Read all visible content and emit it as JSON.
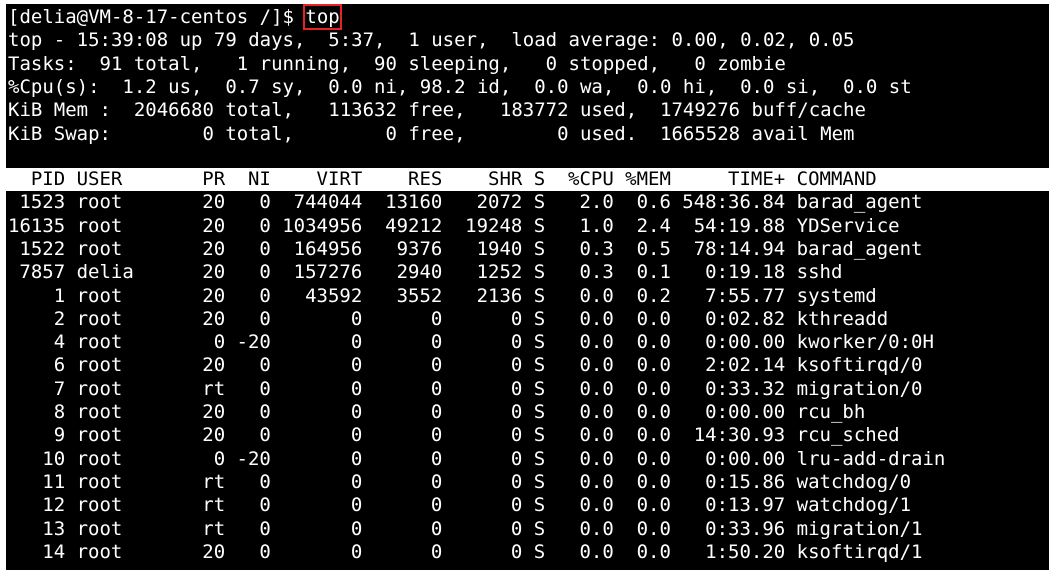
{
  "prompt": {
    "text": "[delia@VM-8-17-centos /]$ ",
    "command": "top"
  },
  "summary": [
    "top - 15:39:08 up 79 days,  5:37,  1 user,  load average: 0.00, 0.02, 0.05",
    "Tasks:  91 total,   1 running,  90 sleeping,   0 stopped,   0 zombie",
    "%Cpu(s):  1.2 us,  0.7 sy,  0.0 ni, 98.2 id,  0.0 wa,  0.0 hi,  0.0 si,  0.0 st",
    "KiB Mem :  2046680 total,   113632 free,   183772 used,  1749276 buff/cache",
    "KiB Swap:        0 total,        0 free,        0 used.  1665528 avail Mem"
  ],
  "columns": [
    "PID",
    "USER",
    "PR",
    "NI",
    "VIRT",
    "RES",
    "SHR",
    "S",
    "%CPU",
    "%MEM",
    "TIME+",
    "COMMAND"
  ],
  "rows": [
    [
      "1523",
      "root",
      "20",
      "0",
      "744044",
      "13160",
      "2072",
      "S",
      "2.0",
      "0.6",
      "548:36.84",
      "barad_agent"
    ],
    [
      "16135",
      "root",
      "20",
      "0",
      "1034956",
      "49212",
      "19248",
      "S",
      "1.0",
      "2.4",
      "54:19.88",
      "YDService"
    ],
    [
      "1522",
      "root",
      "20",
      "0",
      "164956",
      "9376",
      "1940",
      "S",
      "0.3",
      "0.5",
      "78:14.94",
      "barad_agent"
    ],
    [
      "7857",
      "delia",
      "20",
      "0",
      "157276",
      "2940",
      "1252",
      "S",
      "0.3",
      "0.1",
      "0:19.18",
      "sshd"
    ],
    [
      "1",
      "root",
      "20",
      "0",
      "43592",
      "3552",
      "2136",
      "S",
      "0.0",
      "0.2",
      "7:55.77",
      "systemd"
    ],
    [
      "2",
      "root",
      "20",
      "0",
      "0",
      "0",
      "0",
      "S",
      "0.0",
      "0.0",
      "0:02.82",
      "kthreadd"
    ],
    [
      "4",
      "root",
      "0",
      "-20",
      "0",
      "0",
      "0",
      "S",
      "0.0",
      "0.0",
      "0:00.00",
      "kworker/0:0H"
    ],
    [
      "6",
      "root",
      "20",
      "0",
      "0",
      "0",
      "0",
      "S",
      "0.0",
      "0.0",
      "2:02.14",
      "ksoftirqd/0"
    ],
    [
      "7",
      "root",
      "rt",
      "0",
      "0",
      "0",
      "0",
      "S",
      "0.0",
      "0.0",
      "0:33.32",
      "migration/0"
    ],
    [
      "8",
      "root",
      "20",
      "0",
      "0",
      "0",
      "0",
      "S",
      "0.0",
      "0.0",
      "0:00.00",
      "rcu_bh"
    ],
    [
      "9",
      "root",
      "20",
      "0",
      "0",
      "0",
      "0",
      "S",
      "0.0",
      "0.0",
      "14:30.93",
      "rcu_sched"
    ],
    [
      "10",
      "root",
      "0",
      "-20",
      "0",
      "0",
      "0",
      "S",
      "0.0",
      "0.0",
      "0:00.00",
      "lru-add-drain"
    ],
    [
      "11",
      "root",
      "rt",
      "0",
      "0",
      "0",
      "0",
      "S",
      "0.0",
      "0.0",
      "0:15.86",
      "watchdog/0"
    ],
    [
      "12",
      "root",
      "rt",
      "0",
      "0",
      "0",
      "0",
      "S",
      "0.0",
      "0.0",
      "0:13.97",
      "watchdog/1"
    ],
    [
      "13",
      "root",
      "rt",
      "0",
      "0",
      "0",
      "0",
      "S",
      "0.0",
      "0.0",
      "0:33.96",
      "migration/1"
    ],
    [
      "14",
      "root",
      "20",
      "0",
      "0",
      "0",
      "0",
      "S",
      "0.0",
      "0.0",
      "1:50.20",
      "ksoftirqd/1"
    ]
  ]
}
